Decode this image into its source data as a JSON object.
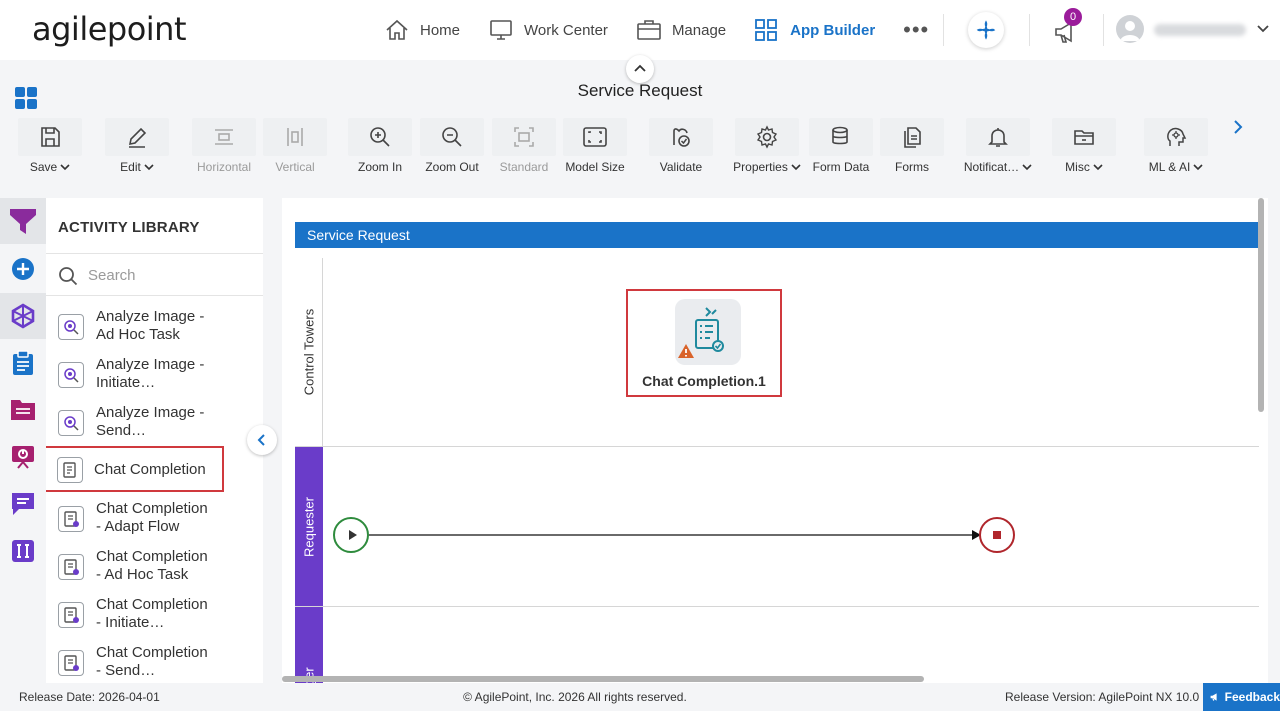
{
  "brand": {
    "logo_text": "agilepoint"
  },
  "nav": {
    "items": [
      {
        "label": "Home",
        "icon": "home-icon"
      },
      {
        "label": "Work Center",
        "icon": "monitor-icon"
      },
      {
        "label": "Manage",
        "icon": "briefcase-icon"
      },
      {
        "label": "App Builder",
        "icon": "grid-icon",
        "active": true
      }
    ],
    "more": "•••",
    "notifications_count": "0"
  },
  "page": {
    "title": "Service Request"
  },
  "toolbar": {
    "save": "Save",
    "edit": "Edit",
    "horizontal": "Horizontal",
    "vertical": "Vertical",
    "zoom_in": "Zoom In",
    "zoom_out": "Zoom Out",
    "standard": "Standard",
    "model_size": "Model Size",
    "validate": "Validate",
    "properties": "Properties",
    "form_data": "Form Data",
    "forms": "Forms",
    "notifications": "Notificat…",
    "misc": "Misc",
    "ml_ai": "ML & AI"
  },
  "library": {
    "title": "ACTIVITY LIBRARY",
    "search_placeholder": "Search",
    "items": [
      {
        "line1": "Analyze Image -",
        "line2": "Ad Hoc Task"
      },
      {
        "line1": "Analyze Image -",
        "line2": "Initiate…"
      },
      {
        "line1": "Analyze Image -",
        "line2": "Send…"
      },
      {
        "line1": "Chat Completion",
        "line2": ""
      },
      {
        "line1": "Chat Completion",
        "line2": "- Adapt Flow"
      },
      {
        "line1": "Chat Completion",
        "line2": "- Ad Hoc Task"
      },
      {
        "line1": "Chat Completion",
        "line2": "- Initiate…"
      },
      {
        "line1": "Chat Completion",
        "line2": "- Send…"
      }
    ]
  },
  "canvas": {
    "pool_title": "Service Request",
    "lanes": [
      "Control Towers",
      "Requester",
      "anager"
    ],
    "activity_label": "Chat Completion.1"
  },
  "colors": {
    "accent": "#1a73c8",
    "highlight": "#d0393e",
    "requester_lane": "#6a3cc9",
    "start": "#2e8b3d",
    "end": "#b0262c"
  },
  "footer": {
    "release_date": "Release Date: 2026-04-01",
    "copyright": "© AgilePoint, Inc. 2026 All rights reserved.",
    "version": "Release Version: AgilePoint NX 10.0",
    "feedback": "Feedback"
  }
}
